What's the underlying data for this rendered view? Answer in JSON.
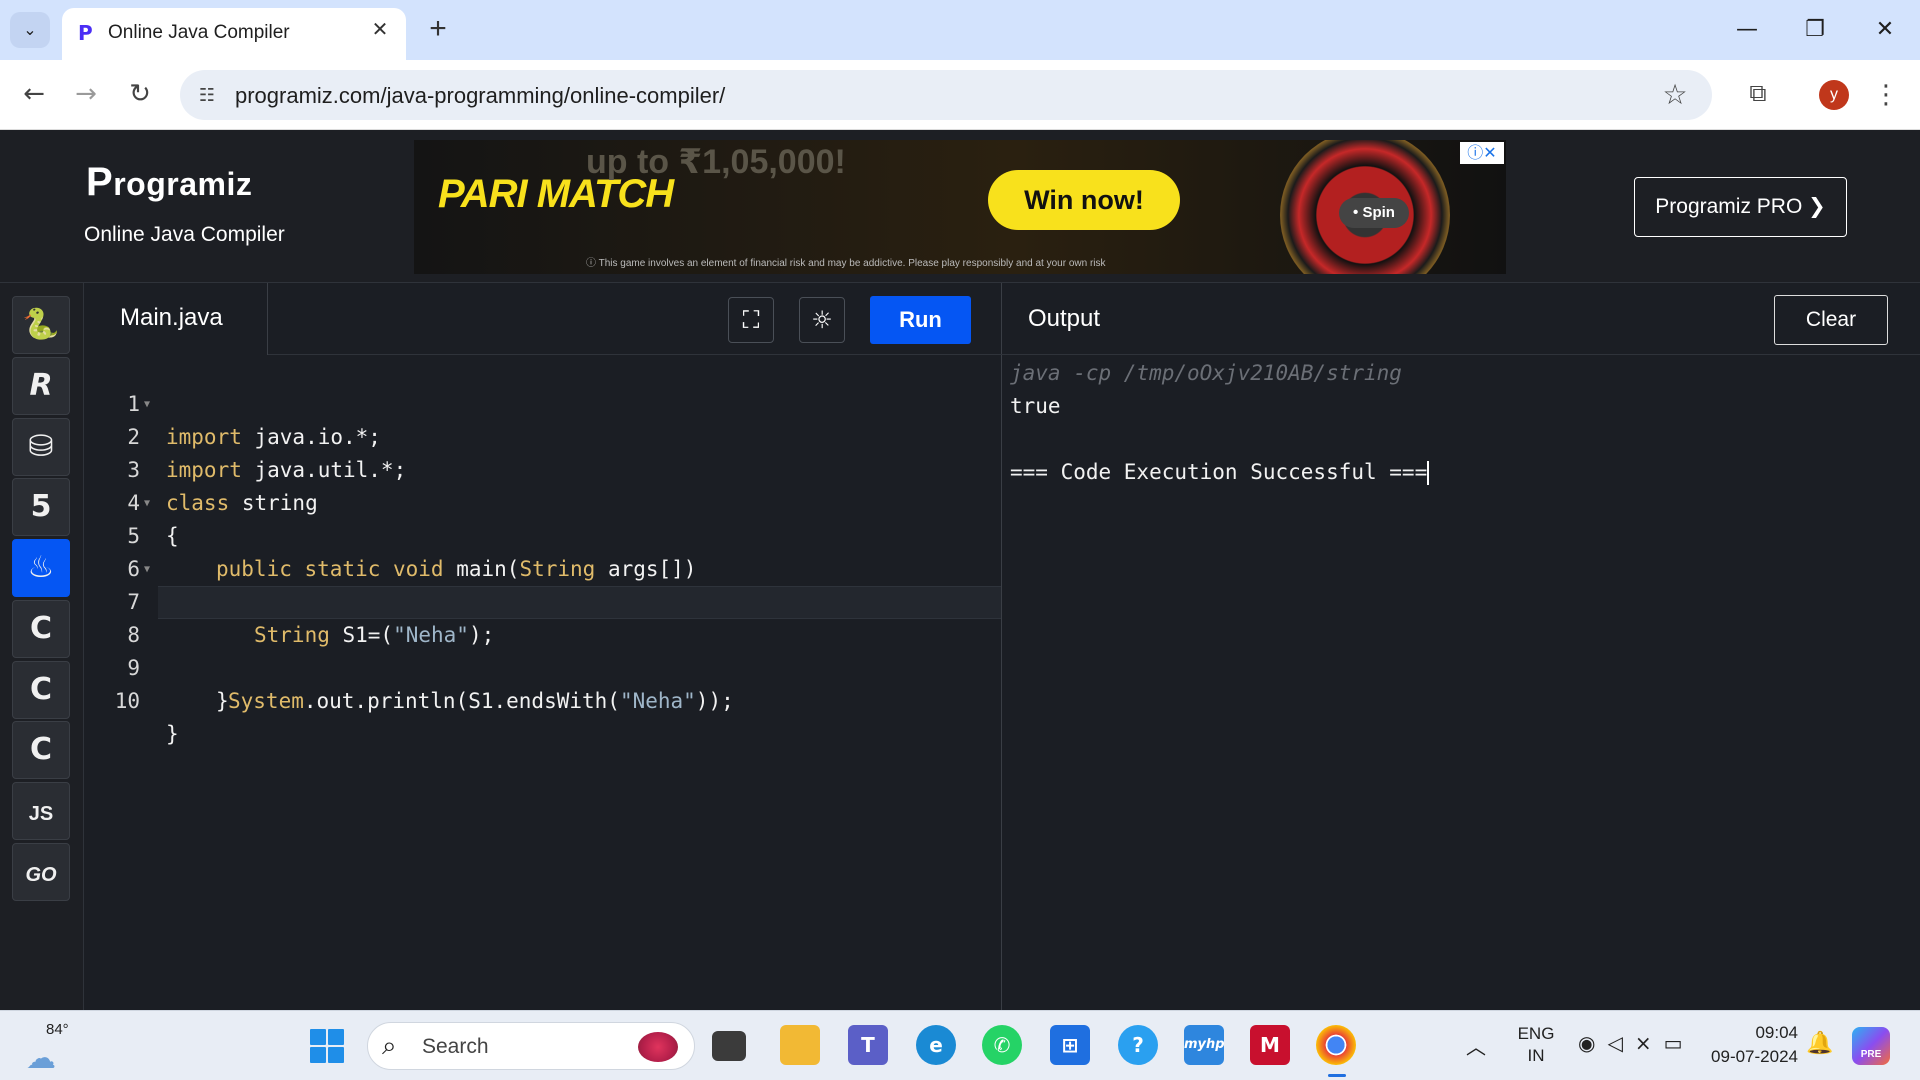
{
  "browser": {
    "tab_title": "Online Java Compiler",
    "url": "programiz.com/java-programming/online-compiler/",
    "profile_initial": "y"
  },
  "site": {
    "logo_text": "rogramiz",
    "logo_letter": "P",
    "compiler_title": "Online Java Compiler",
    "pro_button": "Programiz PRO ❯"
  },
  "ad": {
    "brand": "PARI MATCH",
    "headline": "up to ₹1,05,000!",
    "cta": "Win now!",
    "spin": "• Spin",
    "disclaimer": "ⓘ This game involves an element of financial risk and may be addictive. Please play responsibly and at your own risk"
  },
  "sidebar": {
    "languages": [
      {
        "name": "python",
        "glyph": "🐍"
      },
      {
        "name": "r",
        "glyph": "R"
      },
      {
        "name": "sql",
        "glyph": "⛁"
      },
      {
        "name": "html",
        "glyph": "5"
      },
      {
        "name": "java",
        "glyph": "♨"
      },
      {
        "name": "c",
        "glyph": "C"
      },
      {
        "name": "cpp",
        "glyph": "C"
      },
      {
        "name": "csharp",
        "glyph": "C"
      },
      {
        "name": "js",
        "glyph": "JS"
      },
      {
        "name": "go",
        "glyph": "GO"
      }
    ]
  },
  "editor": {
    "file_name": "Main.java",
    "run_label": "Run",
    "lines": [
      {
        "n": "1",
        "fold": true
      },
      {
        "n": "2",
        "fold": false
      },
      {
        "n": "3",
        "fold": false
      },
      {
        "n": "4",
        "fold": true
      },
      {
        "n": "5",
        "fold": false
      },
      {
        "n": "6",
        "fold": true
      },
      {
        "n": "7",
        "fold": false
      },
      {
        "n": "8",
        "fold": false
      },
      {
        "n": "9",
        "fold": false
      },
      {
        "n": "10",
        "fold": false
      }
    ],
    "code": {
      "l1_kw": "import",
      "l1_rest": " java.io.*;",
      "l2_kw": "import",
      "l2_rest": " java.util.*;",
      "l3_kw": "class",
      "l3_rest": " string",
      "l4": "{",
      "l5_kw": "public static void",
      "l5_rest": " main(",
      "l5_type": "String",
      "l5_end": " args[])",
      "l6": "{",
      "l7_type": "String",
      "l7_mid": " S1=(",
      "l7_str": "\"Neha\"",
      "l7_end": ");",
      "l8_pre": "System",
      "l8_mid": ".out.println(S1.endsWith(",
      "l8_str": "\"Neha\"",
      "l8_end": "));",
      "l9": "}",
      "l10": "}"
    }
  },
  "output": {
    "title": "Output",
    "clear_label": "Clear",
    "command": "java -cp /tmp/oOxjv210AB/string",
    "result": "true",
    "status": "=== Code Execution Successful ==="
  },
  "taskbar": {
    "temperature": "84°",
    "search_placeholder": "Search",
    "lang_line1": "ENG",
    "lang_line2": "IN",
    "time": "09:04",
    "date": "09-07-2024",
    "copilot_badge": "PRE"
  }
}
